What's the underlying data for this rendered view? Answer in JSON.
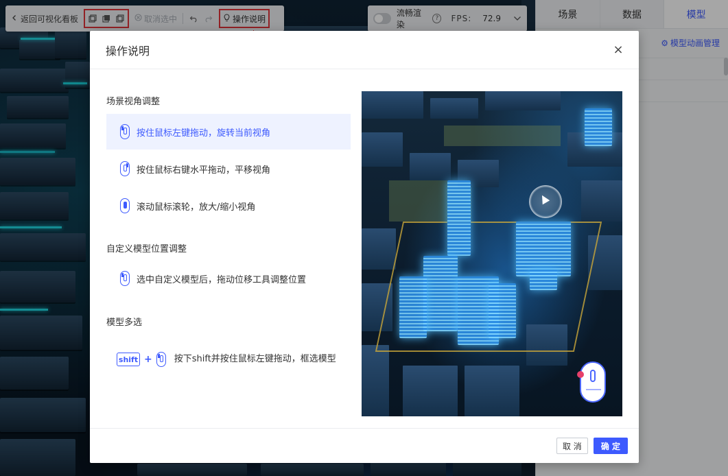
{
  "toolbar": {
    "back_label": "返回可视化看板",
    "deselect_label": "取消选中",
    "help_label": "操作说明"
  },
  "perf": {
    "smooth_label": "流畅渲染",
    "fps_label": "FPS:",
    "fps_value": "72.9"
  },
  "right_panel": {
    "tabs": [
      {
        "label": "场景"
      },
      {
        "label": "数据"
      },
      {
        "label": "模型"
      }
    ],
    "active_tab": "模型",
    "link_label": "模型动画管理"
  },
  "modal": {
    "title": "操作说明",
    "close": "×",
    "sections": [
      {
        "title": "场景视角调整",
        "items": [
          {
            "text": "按住鼠标左键拖动，旋转当前视角",
            "active": true
          },
          {
            "text": "按住鼠标右键水平拖动，平移视角"
          },
          {
            "text": "滚动鼠标滚轮，放大/缩小视角"
          }
        ]
      },
      {
        "title": "自定义模型位置调整",
        "items": [
          {
            "text": "选中自定义模型后，拖动位移工具调整位置"
          }
        ]
      },
      {
        "title": "模型多选",
        "items": [
          {
            "key": "shift",
            "plus": "+",
            "text": "按下shift并按住鼠标左键拖动，框选模型"
          }
        ]
      }
    ],
    "cancel_label": "取 消",
    "ok_label": "确 定"
  },
  "colors": {
    "accent": "#3d5afe",
    "highlight_border": "#e0343a",
    "active_item_bg": "#eef2ff"
  }
}
